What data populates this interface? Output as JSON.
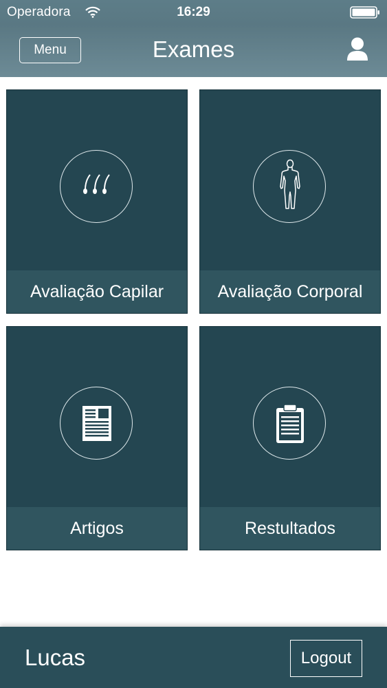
{
  "status_bar": {
    "carrier": "Operadora",
    "time": "16:29",
    "wifi_icon": "wifi-icon",
    "battery_icon": "battery-full-icon"
  },
  "nav": {
    "menu_label": "Menu",
    "title": "Exames",
    "profile_icon": "user-icon"
  },
  "tiles": [
    {
      "label": "Avaliação Capilar",
      "icon": "hair-follicle-icon"
    },
    {
      "label": "Avaliação Corporal",
      "icon": "human-body-icon"
    },
    {
      "label": "Artigos",
      "icon": "article-icon"
    },
    {
      "label": "Restultados",
      "icon": "clipboard-icon"
    }
  ],
  "footer": {
    "user_name": "Lucas",
    "logout_label": "Logout"
  },
  "colors": {
    "header": "#5d7d88",
    "tile": "#244651",
    "tile_label_bar": "#30555f",
    "footer": "#2a4e59"
  }
}
